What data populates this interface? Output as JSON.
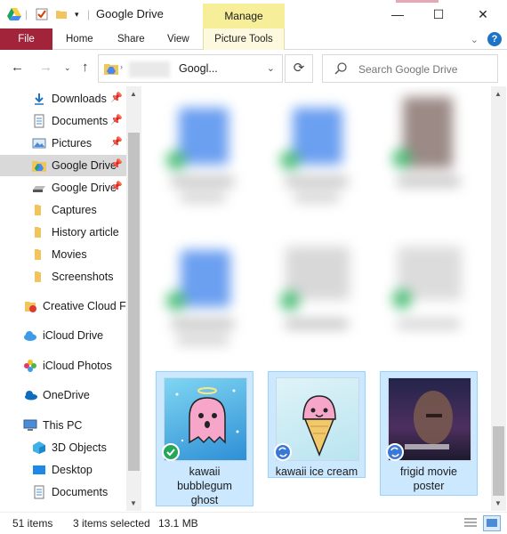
{
  "window": {
    "title": "Google Drive",
    "manage_tab": "Manage",
    "min_glyph": "—",
    "max_glyph": "☐",
    "close_glyph": "✕"
  },
  "ribbon": {
    "tabs": [
      "File",
      "Home",
      "Share",
      "View",
      "Picture Tools"
    ]
  },
  "address": {
    "path_text": "Googl...",
    "search_placeholder": "Search Google Drive"
  },
  "sidebar": {
    "items": [
      {
        "label": "Downloads",
        "icon": "download-icon",
        "pinned": true
      },
      {
        "label": "Documents",
        "icon": "documents-icon",
        "pinned": true
      },
      {
        "label": "Pictures",
        "icon": "pictures-icon",
        "pinned": true
      },
      {
        "label": "Google Drive",
        "icon": "google-drive-icon",
        "pinned": true,
        "selected": true
      },
      {
        "label": "Google Drive",
        "icon": "drive-disk-icon",
        "pinned": true
      },
      {
        "label": "Captures",
        "icon": "folder-icon"
      },
      {
        "label": "History article",
        "icon": "folder-icon"
      },
      {
        "label": "Movies",
        "icon": "folder-icon"
      },
      {
        "label": "Screenshots",
        "icon": "folder-icon"
      },
      {
        "label": "Creative Cloud Fi",
        "icon": "creative-cloud-icon"
      },
      {
        "label": "iCloud Drive",
        "icon": "icloud-icon"
      },
      {
        "label": "iCloud Photos",
        "icon": "icloud-photos-icon"
      },
      {
        "label": "OneDrive",
        "icon": "onedrive-icon"
      },
      {
        "label": "This PC",
        "icon": "pc-icon"
      },
      {
        "label": "3D Objects",
        "icon": "3d-objects-icon"
      },
      {
        "label": "Desktop",
        "icon": "desktop-icon"
      },
      {
        "label": "Documents",
        "icon": "documents-icon"
      }
    ]
  },
  "files": {
    "selected": [
      {
        "name_lines": [
          "kawaii",
          "bubblegum",
          "ghost"
        ],
        "status": "synced"
      },
      {
        "name_lines": [
          "kawaii ice cream"
        ],
        "status": "syncing"
      },
      {
        "name_lines": [
          "frigid movie",
          "poster"
        ],
        "status": "syncing"
      }
    ]
  },
  "statusbar": {
    "item_count": "51 items",
    "selected_count": "3 items selected",
    "selected_size": "13.1 MB"
  },
  "colors": {
    "file_tab": "#a1243a",
    "manage_tab": "#f7ee9a",
    "selection": "#cce8ff",
    "accent": "#1e73c8"
  }
}
